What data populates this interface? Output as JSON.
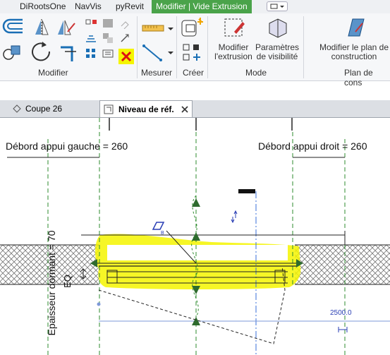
{
  "ribbon_tabs": [
    {
      "label": "DiRootsOne",
      "active": false
    },
    {
      "label": "NavVis",
      "active": false
    },
    {
      "label": "pyRevit",
      "active": false
    },
    {
      "label": "Modifier | Vide Extrusion",
      "active": true
    }
  ],
  "ribbon": {
    "panels": {
      "modifier": "Modifier",
      "mesurer": "Mesurer",
      "creer": "Créer",
      "mode": "Mode",
      "plan_construction": "Plan de cons"
    },
    "buttons": {
      "modifier_extrusion": "Modifier l'extrusion",
      "parametres_visibilite": "Paramètres de visibilité",
      "modifier_plan": "Modifier le plan de construction"
    },
    "accent_color": "#4aa34a"
  },
  "view_tabs": [
    {
      "label": "Coupe 26",
      "active": false
    },
    {
      "label": "Niveau de réf.",
      "active": true
    }
  ],
  "canvas": {
    "dim_left": "Débord appui gauche = 260",
    "dim_right": "Débord appui droit = 260",
    "dim_vertical": "Epaisseur dormant = 70",
    "eq_label": "EQ",
    "dim_value": "2500.0",
    "highlight_color": "#f5f500",
    "grid_color": "#2e8b2e"
  }
}
